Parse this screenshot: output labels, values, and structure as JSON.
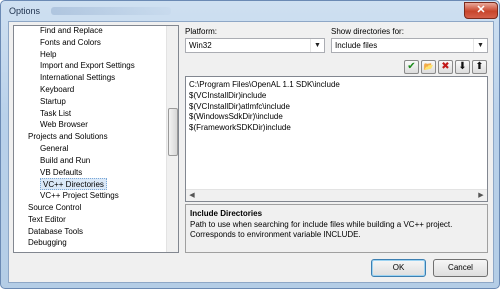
{
  "window": {
    "title": "Options",
    "close_glyph": "✕"
  },
  "tree": {
    "items": [
      "Find and Replace",
      "Fonts and Colors",
      "Help",
      "Import and Export Settings",
      "International Settings",
      "Keyboard",
      "Startup",
      "Task List",
      "Web Browser",
      "Projects and Solutions",
      "General",
      "Build and Run",
      "VB Defaults",
      "VC++ Directories",
      "VC++ Project Settings",
      "Source Control",
      "Text Editor",
      "Database Tools",
      "Debugging"
    ],
    "selected": "VC++ Directories"
  },
  "platform": {
    "label": "Platform:",
    "value": "Win32"
  },
  "show_dirs": {
    "label": "Show directories for:",
    "value": "Include files"
  },
  "toolbar": {
    "buttons": [
      {
        "name": "check-icon",
        "glyph": "✔"
      },
      {
        "name": "new-folder-icon",
        "glyph": "📂"
      },
      {
        "name": "delete-icon",
        "glyph": "✖"
      },
      {
        "name": "move-down-icon",
        "glyph": "⬇"
      },
      {
        "name": "move-up-icon",
        "glyph": "⬆"
      }
    ]
  },
  "directories": [
    "C:\\Program Files\\OpenAL 1.1 SDK\\include",
    "$(VCInstallDir)include",
    "$(VCInstallDir)atlmfc\\include",
    "$(WindowsSdkDir)\\include",
    "$(FrameworkSDKDir)include"
  ],
  "description": {
    "title": "Include Directories",
    "text": "Path to use when searching for include files while building a VC++ project. Corresponds to environment variable INCLUDE."
  },
  "buttons": {
    "ok": "OK",
    "cancel": "Cancel"
  },
  "colors": {
    "title_bar": "#b9d1ea",
    "close": "#c8452b",
    "selection": "#dbe9f8"
  }
}
